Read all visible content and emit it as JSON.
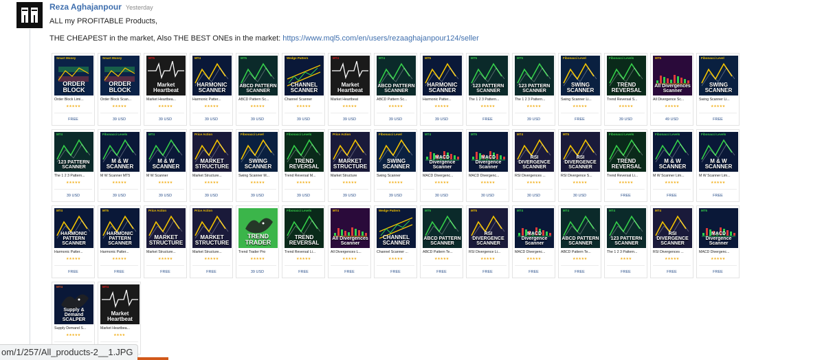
{
  "message": {
    "author": "Reza Aghajanpour",
    "timestamp": "Yesterday",
    "line1": "ALL my PROFITABLE Products,",
    "line2_prefix": "THE CHEAPEST in the market, Also THE BEST ONEs in the market: ",
    "link": "https://www.mql5.com/en/users/rezaaghajanpour124/seller"
  },
  "status_bar": "om/1/257/All_products-2__1.JPG",
  "products": [
    {
      "name": "Order Block Limi...",
      "price": "FREE",
      "rating": "★★★★★",
      "t1": "ORDER BLOCK",
      "t2": "Smart Money",
      "bg": "#0b2247",
      "accent": "#f5c400",
      "icon": "chart-blocks"
    },
    {
      "name": "Order Block Scan...",
      "price": "39 USD",
      "rating": "★★★★★",
      "t1": "ORDER BLOCK",
      "t2": "Smart Money",
      "bg": "#0b2247",
      "accent": "#f5c400",
      "icon": "chart-blocks"
    },
    {
      "name": "Market Heartbea...",
      "price": "39 USD",
      "rating": "★★★★★",
      "t1": "Market Heartbeat",
      "t2": "MT5",
      "bg": "#1a1a1a",
      "accent": "#e21b1b",
      "icon": "heartbeat"
    },
    {
      "name": "Harmonic Patter...",
      "price": "39 USD",
      "rating": "★★★★★",
      "t1": "HARMONIC SCANNER",
      "t2": "MT4",
      "bg": "#0a1838",
      "accent": "#f5c400",
      "icon": "zigzag"
    },
    {
      "name": "ABCD Pattern Sc...",
      "price": "39 USD",
      "rating": "★★★★★",
      "t1": "ABCD PATTERN SCANNER",
      "t2": "MT5",
      "bg": "#0b2a2a",
      "accent": "#35d04a",
      "icon": "zigzag"
    },
    {
      "name": "Channel Scanner",
      "price": "39 USD",
      "rating": "★★★★★",
      "t1": "CHANNEL SCANNER",
      "t2": "Wedge Pattern",
      "bg": "#0a1838",
      "accent": "#f5c400",
      "icon": "channel"
    },
    {
      "name": "Market Heartbeat",
      "price": "39 USD",
      "rating": "★★★★★",
      "t1": "Market Heartbeat",
      "t2": "MT4",
      "bg": "#1a1a1a",
      "accent": "#e21b1b",
      "icon": "heartbeat"
    },
    {
      "name": "ABCD Pattern Sc...",
      "price": "39 USD",
      "rating": "★★★★★",
      "t1": "ABCD PATTERN SCANNER",
      "t2": "MT4",
      "bg": "#0b2a2a",
      "accent": "#35d04a",
      "icon": "zigzag"
    },
    {
      "name": "Harmonic Patter...",
      "price": "39 USD",
      "rating": "★★★★★",
      "t1": "HARMONIC SCANNER",
      "t2": "MT5",
      "bg": "#0a1838",
      "accent": "#f5c400",
      "icon": "zigzag"
    },
    {
      "name": "The 1 2 3 Pattern...",
      "price": "FREE",
      "rating": "★★★★★",
      "t1": "123 PATTERN SCANNER",
      "t2": "MT5",
      "bg": "#0b2a2a",
      "accent": "#35d04a",
      "icon": "zigzag"
    },
    {
      "name": "The 1 2 3 Pattern...",
      "price": "39 USD",
      "rating": "★★★★★",
      "t1": "123 PATTERN SCANNER",
      "t2": "MT5",
      "bg": "#0b2a2a",
      "accent": "#35d04a",
      "icon": "zigzag"
    },
    {
      "name": "Swing Scanner Li...",
      "price": "FREE",
      "rating": "★★★★★",
      "t1": "SWING SCANNER",
      "t2": "Fibonacci Level",
      "bg": "#0a2040",
      "accent": "#f5c400",
      "icon": "zigzag"
    },
    {
      "name": "Trend Reversal S...",
      "price": "39 USD",
      "rating": "★★★★★",
      "t1": "TREND REVERSAL",
      "t2": "Fibonacci Levels",
      "bg": "#0a2a1a",
      "accent": "#35d04a",
      "icon": "zigzag"
    },
    {
      "name": "All Divergence Sc...",
      "price": "49 USD",
      "rating": "★★★★★",
      "t1": "All Divergences Scanner",
      "t2": "MT5",
      "bg": "#2a0a3a",
      "accent": "#f5c400",
      "icon": "bars"
    },
    {
      "name": "Swing Scanner Li...",
      "price": "FREE",
      "rating": "★★★★★",
      "t1": "SWING SCANNER",
      "t2": "Fibonacci Level",
      "bg": "#0a2040",
      "accent": "#f5c400",
      "icon": "zigzag"
    },
    {
      "name": "The 1 2 3 Pattern...",
      "price": "39 USD",
      "rating": "★★★★★",
      "t1": "123 PATTERN SCANNER",
      "t2": "MT4",
      "bg": "#0b2a2a",
      "accent": "#35d04a",
      "icon": "zigzag"
    },
    {
      "name": "M W Scanner MT5",
      "price": "39 USD",
      "rating": "★★★★★",
      "t1": "M & W SCANNER",
      "t2": "Fibonacci Levels",
      "bg": "#0a1838",
      "accent": "#35d04a",
      "icon": "zigzag"
    },
    {
      "name": "M W Scanner",
      "price": "39 USD",
      "rating": "★★★★★",
      "t1": "M & W SCANNER",
      "t2": "MT4",
      "bg": "#0a1838",
      "accent": "#35d04a",
      "icon": "zigzag"
    },
    {
      "name": "Market Structure...",
      "price": "39 USD",
      "rating": "★★★★★",
      "t1": "MARKET STRUCTURE",
      "t2": "Price Action",
      "bg": "#1a1a3a",
      "accent": "#f5c400",
      "icon": "zigzag"
    },
    {
      "name": "Swing Scanner M...",
      "price": "39 USD",
      "rating": "★★★★★",
      "t1": "SWING SCANNER",
      "t2": "Fibonacci Level",
      "bg": "#0a2040",
      "accent": "#f5c400",
      "icon": "zigzag"
    },
    {
      "name": "Trend Reversal M...",
      "price": "39 USD",
      "rating": "★★★★★",
      "t1": "TREND REVERSAL",
      "t2": "Fibonacci Levels",
      "bg": "#0a2a1a",
      "accent": "#35d04a",
      "icon": "zigzag"
    },
    {
      "name": "Market Structure",
      "price": "39 USD",
      "rating": "★★★★★",
      "t1": "MARKET STRUCTURE",
      "t2": "Price Action",
      "bg": "#1a1a3a",
      "accent": "#f5c400",
      "icon": "zigzag"
    },
    {
      "name": "Swing Scanner",
      "price": "39 USD",
      "rating": "★★★★★",
      "t1": "SWING SCANNER",
      "t2": "Fibonacci Level",
      "bg": "#0a2040",
      "accent": "#f5c400",
      "icon": "zigzag"
    },
    {
      "name": "MACD Divergenc...",
      "price": "30 USD",
      "rating": "★★★★★",
      "t1": "MACD Divergence Scanner",
      "t2": "MT4",
      "bg": "#0a1838",
      "accent": "#35d04a",
      "icon": "bars"
    },
    {
      "name": "MACD Divergenc...",
      "price": "30 USD",
      "rating": "★★★★★",
      "t1": "MACD Divergence Scanner",
      "t2": "MT5",
      "bg": "#0a1838",
      "accent": "#35d04a",
      "icon": "bars"
    },
    {
      "name": "RSI Divergences ...",
      "price": "30 USD",
      "rating": "★★★★★",
      "t1": "RSI DIVERGENCE SCANNER",
      "t2": "MT4",
      "bg": "#1a1a3a",
      "accent": "#f5c400",
      "icon": "zigzag"
    },
    {
      "name": "RSI Divergence S...",
      "price": "30 USD",
      "rating": "★★★★★",
      "t1": "RSI DIVERGENCE SCANNER",
      "t2": "MT5",
      "bg": "#1a1a3a",
      "accent": "#f5c400",
      "icon": "zigzag"
    },
    {
      "name": "Trend Reversal Li...",
      "price": "FREE",
      "rating": "★★★★★",
      "t1": "TREND REVERSAL",
      "t2": "Fibonacci Levels",
      "bg": "#0a2a1a",
      "accent": "#35d04a",
      "icon": "zigzag"
    },
    {
      "name": "M W Scanner Lim...",
      "price": "FREE",
      "rating": "★★★★★",
      "t1": "M & W SCANNER",
      "t2": "Fibonacci Levels",
      "bg": "#0a1838",
      "accent": "#35d04a",
      "icon": "zigzag"
    },
    {
      "name": "M W Scanner Lim...",
      "price": "FREE",
      "rating": "★★★★★",
      "t1": "M & W SCANNER",
      "t2": "Fibonacci Levels",
      "bg": "#0a1838",
      "accent": "#35d04a",
      "icon": "zigzag"
    },
    {
      "name": "Harmonic Patter...",
      "price": "FREE",
      "rating": "★★★★★",
      "t1": "HARMONIC PATTERN SCANNER",
      "t2": "MT4",
      "bg": "#0a1838",
      "accent": "#f5c400",
      "icon": "zigzag"
    },
    {
      "name": "Harmonic Patter...",
      "price": "FREE",
      "rating": "★★★★★",
      "t1": "HARMONIC PATTERN SCANNER",
      "t2": "MT5",
      "bg": "#0a1838",
      "accent": "#f5c400",
      "icon": "zigzag"
    },
    {
      "name": "Market Structure...",
      "price": "FREE",
      "rating": "★★★★★",
      "t1": "MARKET STRUCTURE",
      "t2": "Price Action",
      "bg": "#1a1a3a",
      "accent": "#f5c400",
      "icon": "zigzag"
    },
    {
      "name": "Market Structure...",
      "price": "FREE",
      "rating": "★★★★★",
      "t1": "MARKET STRUCTURE",
      "t2": "Price Action",
      "bg": "#1a1a3a",
      "accent": "#f5c400",
      "icon": "zigzag"
    },
    {
      "name": "Trend Trader Pro",
      "price": "39 USD",
      "rating": "★★★★★",
      "t1": "TREND TRADER",
      "t2": "",
      "bg": "#3bb54a",
      "accent": "#ffffff",
      "icon": "bull"
    },
    {
      "name": "Trend Reversal Li...",
      "price": "FREE",
      "rating": "★★★★★",
      "t1": "TREND REVERSAL",
      "t2": "Fibonacci Levels",
      "bg": "#0a2a1a",
      "accent": "#35d04a",
      "icon": "zigzag"
    },
    {
      "name": "All Divergences L...",
      "price": "FREE",
      "rating": "★★★★★",
      "t1": "All Divergences Scanner",
      "t2": "MT4",
      "bg": "#2a0a3a",
      "accent": "#f5c400",
      "icon": "bars"
    },
    {
      "name": "Channel Scanner ...",
      "price": "FREE",
      "rating": "★★★★★",
      "t1": "CHANNEL SCANNER",
      "t2": "Wedge Pattern",
      "bg": "#0a1838",
      "accent": "#f5c400",
      "icon": "channel"
    },
    {
      "name": "ABCD Pattern Te...",
      "price": "FREE",
      "rating": "★★★★★",
      "t1": "ABCD PATTERN SCANNER",
      "t2": "MT5",
      "bg": "#0b2a2a",
      "accent": "#35d04a",
      "icon": "zigzag"
    },
    {
      "name": "RSI Divergence Li...",
      "price": "FREE",
      "rating": "★★★★★",
      "t1": "RSI DIVERGENCE SCANNER",
      "t2": "MT5",
      "bg": "#1a1a3a",
      "accent": "#f5c400",
      "icon": "zigzag"
    },
    {
      "name": "MACD Divergenc...",
      "price": "FREE",
      "rating": "★★★★★",
      "t1": "MACD Divergence Scanner",
      "t2": "MT4",
      "bg": "#0a1838",
      "accent": "#35d04a",
      "icon": "bars"
    },
    {
      "name": "ABCD Pattern Te...",
      "price": "FREE",
      "rating": "★★★★★",
      "t1": "ABCD PATTERN SCANNER",
      "t2": "MT4",
      "bg": "#0b2a2a",
      "accent": "#35d04a",
      "icon": "zigzag"
    },
    {
      "name": "The 1 2 3 Pattern...",
      "price": "FREE",
      "rating": "★★★★",
      "t1": "123 PATTERN SCANNER",
      "t2": "MT4",
      "bg": "#0b2a2a",
      "accent": "#35d04a",
      "icon": "zigzag"
    },
    {
      "name": "RSI Divergences ...",
      "price": "FREE",
      "rating": "★★★★★",
      "t1": "RSI DIVERGENCE SCANNER",
      "t2": "MT4",
      "bg": "#1a1a3a",
      "accent": "#f5c400",
      "icon": "zigzag"
    },
    {
      "name": "MACD Divergenc...",
      "price": "FREE",
      "rating": "★★★★★",
      "t1": "MACD Divergence Scanner",
      "t2": "MT5",
      "bg": "#0a1838",
      "accent": "#35d04a",
      "icon": "bars"
    },
    {
      "name": "Supply Demand S...",
      "price": "FREE",
      "rating": "★★★★★",
      "t1": "Supply & Demand SCALPER",
      "t2": "MT4",
      "bg": "#0a1838",
      "accent": "#e8541e",
      "icon": "bull"
    },
    {
      "name": "Market Heartbea...",
      "price": "FREE",
      "rating": "★★★★",
      "t1": "Market Heartbeat",
      "t2": "MT4",
      "bg": "#1a1a1a",
      "accent": "#e21b1b",
      "icon": "heartbeat"
    }
  ]
}
